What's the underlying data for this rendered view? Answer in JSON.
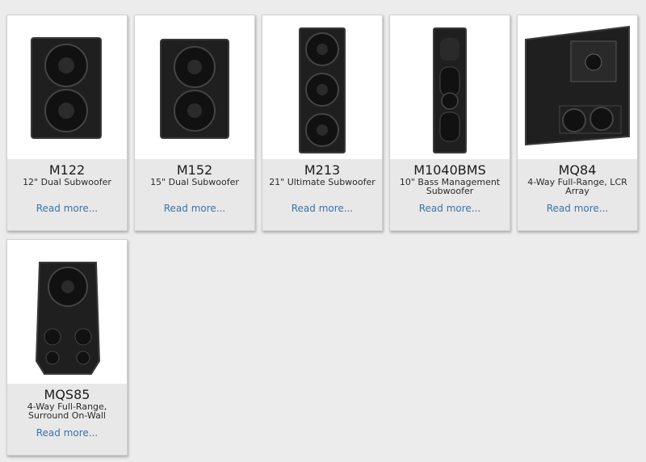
{
  "products": [
    {
      "model": "M122",
      "description": "12\" Dual Subwoofer",
      "link_text": "Read more..."
    },
    {
      "model": "M152",
      "description": "15\" Dual Subwoofer",
      "link_text": "Read more..."
    },
    {
      "model": "M213",
      "description": "21\" Ultimate Subwoofer",
      "link_text": "Read more..."
    },
    {
      "model": "M1040BMS",
      "description": "10\" Bass Management Subwoofer",
      "link_text": "Read more..."
    },
    {
      "model": "MQ84",
      "description": "4-Way Full-Range, LCR Array",
      "link_text": "Read more..."
    },
    {
      "model": "MQS85",
      "description": "4-Way Full-Range, Surround On-Wall",
      "link_text": "Read more..."
    }
  ],
  "colors": {
    "page_background": "#ececec",
    "card_caption_background": "#e8e8e8",
    "link": "#3b73a8",
    "speaker_body": "#1e1e1e"
  }
}
